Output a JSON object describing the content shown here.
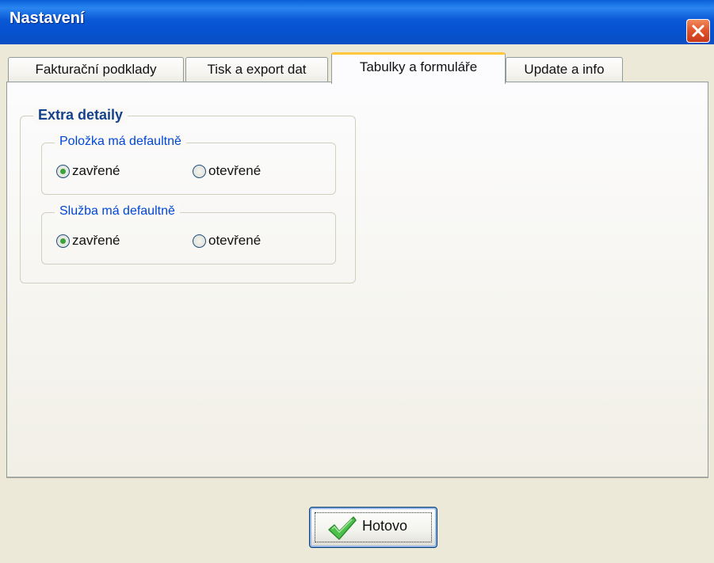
{
  "window": {
    "title": "Nastavení"
  },
  "tabs": [
    {
      "label": "Fakturační podklady",
      "active": false
    },
    {
      "label": "Tisk a export dat",
      "active": false
    },
    {
      "label": "Tabulky a formuláře",
      "active": true
    },
    {
      "label": "Update a info",
      "active": false
    }
  ],
  "extra_details": {
    "legend": "Extra detaily",
    "polozka": {
      "legend": "Položka má defaultně",
      "option_closed": "zavřené",
      "option_open": "otevřené",
      "selected": "zavřené"
    },
    "sluzba": {
      "legend": "Služba má defaultně",
      "option_closed": "zavřené",
      "option_open": "otevřené",
      "selected": "zavřené"
    }
  },
  "footer": {
    "done_label": "Hotovo"
  },
  "icons": {
    "close": "close-icon",
    "done": "checkmark-icon"
  },
  "colors": {
    "titlebar": "#0a58d6",
    "legend_main": "#15428b",
    "legend_sub": "#0046d5",
    "active_tab_accent": "#ffc83c",
    "check": "#4cc24c"
  }
}
